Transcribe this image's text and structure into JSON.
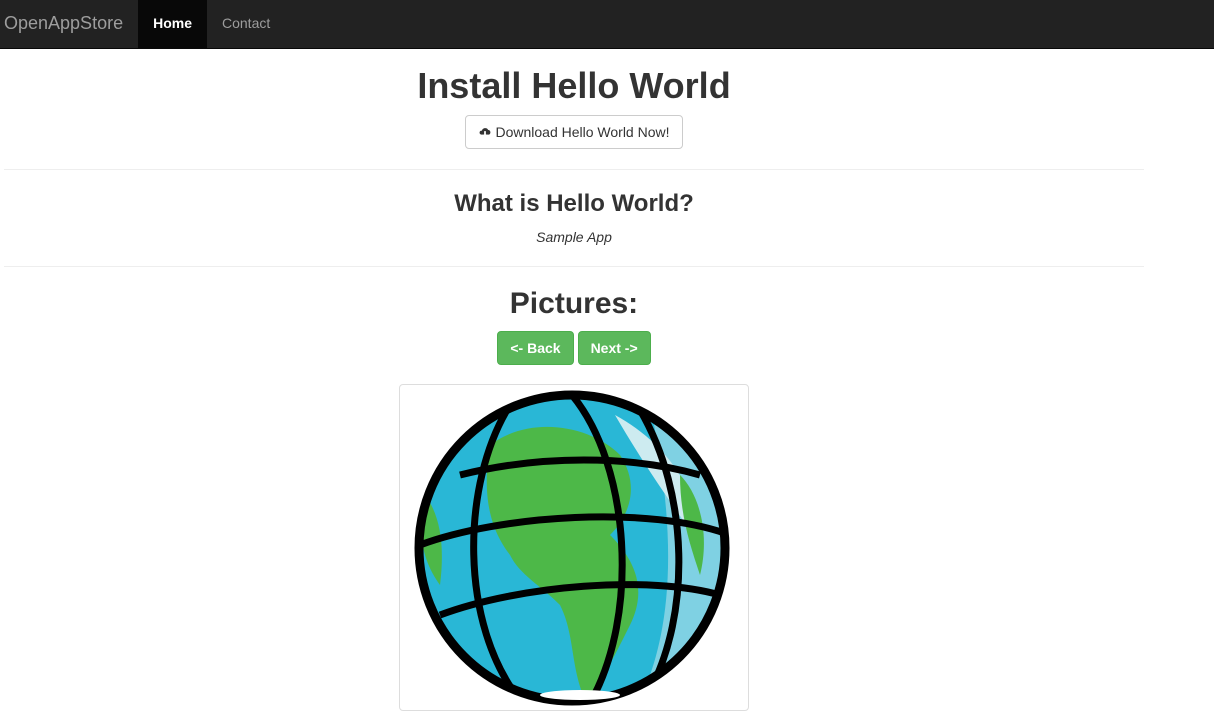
{
  "navbar": {
    "brand": "OpenAppStore",
    "items": [
      {
        "label": "Home",
        "active": true
      },
      {
        "label": "Contact",
        "active": false
      }
    ]
  },
  "main": {
    "title": "Install Hello World",
    "download_button": {
      "label": "Download Hello World Now!",
      "icon": "cloud-download-icon"
    },
    "about_heading": "What is Hello World?",
    "about_text": "Sample App",
    "pictures_heading": "Pictures:",
    "back_button": "<- Back",
    "next_button": "Next ->",
    "picture": {
      "subject": "globe-image"
    }
  },
  "colors": {
    "navbar_bg": "#222222",
    "success": "#5cb85c",
    "ocean": "#29b7d6",
    "land": "#4db848"
  }
}
